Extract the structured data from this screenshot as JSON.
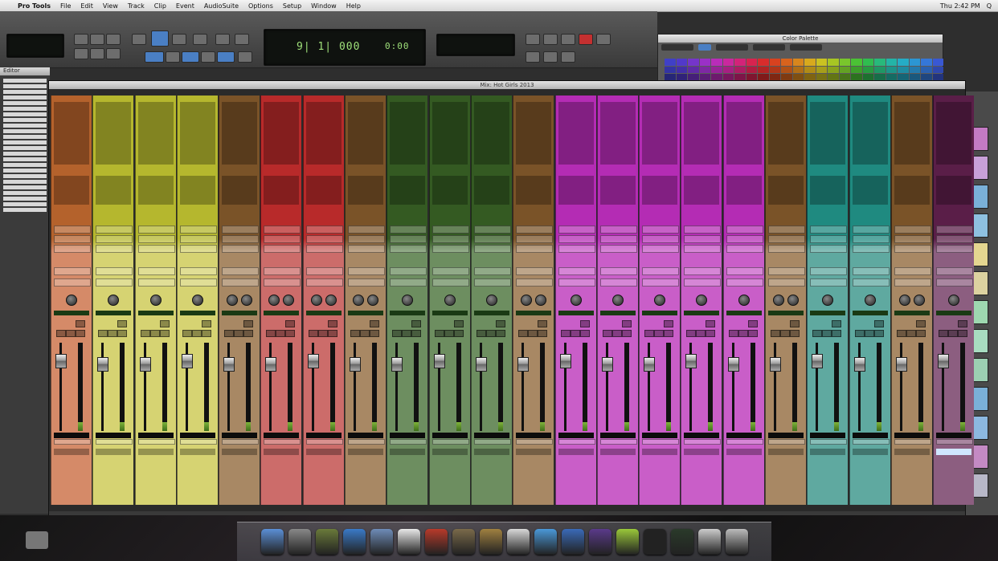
{
  "menubar": {
    "apple": "",
    "items": [
      "Pro Tools",
      "File",
      "Edit",
      "View",
      "Track",
      "Clip",
      "Event",
      "AudioSuite",
      "Options",
      "Setup",
      "Window",
      "Help"
    ],
    "right": [
      "Thu 2:42 PM",
      "Q"
    ]
  },
  "transport": {
    "main_counter": "9| 1| 000",
    "sub_counter": "0:00",
    "buttons": [
      "rewind",
      "fast-forward",
      "stop",
      "play",
      "record"
    ]
  },
  "palette": {
    "title": "Color Palette",
    "colors": [
      "#3a3ab5",
      "#4a34b8",
      "#6a30b8",
      "#8c2cb5",
      "#a828a8",
      "#b82490",
      "#c0206e",
      "#c42048",
      "#c42828",
      "#c43c1c",
      "#c45a1a",
      "#c47a1a",
      "#c49a1a",
      "#b8b01e",
      "#98b420",
      "#6eb428",
      "#44b030",
      "#2cac48",
      "#24a870",
      "#20a498",
      "#229cb4",
      "#2888c0",
      "#306cc4",
      "#3450c0"
    ]
  },
  "edit_window": {
    "title": "Editor",
    "clip_colors": [
      "#c47ac4",
      "#c8a0d8",
      "#7ab0d8",
      "#8ec0e0",
      "#e4d690",
      "#dcd2a0",
      "#9ed8b0",
      "#a8dcc0",
      "#9ccfb2",
      "#7ab0d8",
      "#8cb8e0",
      "#c48ac4",
      "#b8b8c8"
    ]
  },
  "mix_window": {
    "title": "Mix: Hot Girls 2013",
    "strips": [
      {
        "color": "#b4622c",
        "light": "#d58a68",
        "name": "",
        "level": 0.1
      },
      {
        "color": "#b5b72e",
        "light": "#d6d372",
        "name": "",
        "level": 0.1
      },
      {
        "color": "#b5b72e",
        "light": "#d6d372",
        "name": "",
        "level": 0.1
      },
      {
        "color": "#b5b72e",
        "light": "#d6d372",
        "name": "",
        "level": 0.1
      },
      {
        "color": "#7a5328",
        "light": "#a88864",
        "name": "",
        "level": 0.1
      },
      {
        "color": "#b82a2a",
        "light": "#cc6c6a",
        "name": "",
        "level": 0.1
      },
      {
        "color": "#b82a2a",
        "light": "#cc6c6a",
        "name": "",
        "level": 0.1
      },
      {
        "color": "#7a5328",
        "light": "#a88864",
        "name": "",
        "level": 0.1
      },
      {
        "color": "#345a22",
        "light": "#6d8e60",
        "name": "",
        "level": 0.1
      },
      {
        "color": "#345a22",
        "light": "#6d8e60",
        "name": "",
        "level": 0.1
      },
      {
        "color": "#345a22",
        "light": "#6d8e60",
        "name": "",
        "level": 0.1
      },
      {
        "color": "#7a5328",
        "light": "#a88864",
        "name": "",
        "level": 0.1
      },
      {
        "color": "#b42cb4",
        "light": "#c95ec8",
        "name": "",
        "level": 0.1
      },
      {
        "color": "#b42cb4",
        "light": "#c95ec8",
        "name": "",
        "level": 0.1
      },
      {
        "color": "#b42cb4",
        "light": "#c95ec8",
        "name": "",
        "level": 0.1
      },
      {
        "color": "#b42cb4",
        "light": "#c95ec8",
        "name": "",
        "level": 0.1
      },
      {
        "color": "#b42cb4",
        "light": "#c95ec8",
        "name": "",
        "level": 0.1
      },
      {
        "color": "#7a5328",
        "light": "#a88864",
        "name": "",
        "level": 0.1
      },
      {
        "color": "#1f8a80",
        "light": "#5fa9a0",
        "name": "",
        "level": 0.1
      },
      {
        "color": "#1f8a80",
        "light": "#5fa9a0",
        "name": "",
        "level": 0.1
      },
      {
        "color": "#7a5328",
        "light": "#a88864",
        "name": "",
        "level": 0.1
      },
      {
        "color": "#5a1e48",
        "light": "#8c5e80",
        "name": "",
        "level": 0.1,
        "selected": true
      }
    ]
  },
  "dock": {
    "icons": [
      {
        "name": "finder",
        "color": "#5b8fd6"
      },
      {
        "name": "system-preferences",
        "color": "#888888"
      },
      {
        "name": "photo-booth",
        "color": "#6a7a3a"
      },
      {
        "name": "safari",
        "color": "#3a7ac8"
      },
      {
        "name": "mail",
        "color": "#6e8cb8"
      },
      {
        "name": "ical",
        "color": "#e8e8e8"
      },
      {
        "name": "address-book",
        "color": "#b83a2a"
      },
      {
        "name": "iphoto",
        "color": "#7a6a4a"
      },
      {
        "name": "garageband",
        "color": "#a08040"
      },
      {
        "name": "textedit",
        "color": "#d8d8d8"
      },
      {
        "name": "itunes",
        "color": "#4a98d8"
      },
      {
        "name": "preview",
        "color": "#3a6ab8"
      },
      {
        "name": "pro-tools",
        "color": "#5a3a8a"
      },
      {
        "name": "stickies",
        "color": "#9ac83a"
      },
      {
        "name": "terminal",
        "color": "#222222"
      },
      {
        "name": "activity-monitor",
        "color": "#2a3a2a"
      },
      {
        "name": "downloads-stack",
        "color": "#cccccc"
      },
      {
        "name": "trash",
        "color": "#bbbbbb"
      }
    ]
  }
}
